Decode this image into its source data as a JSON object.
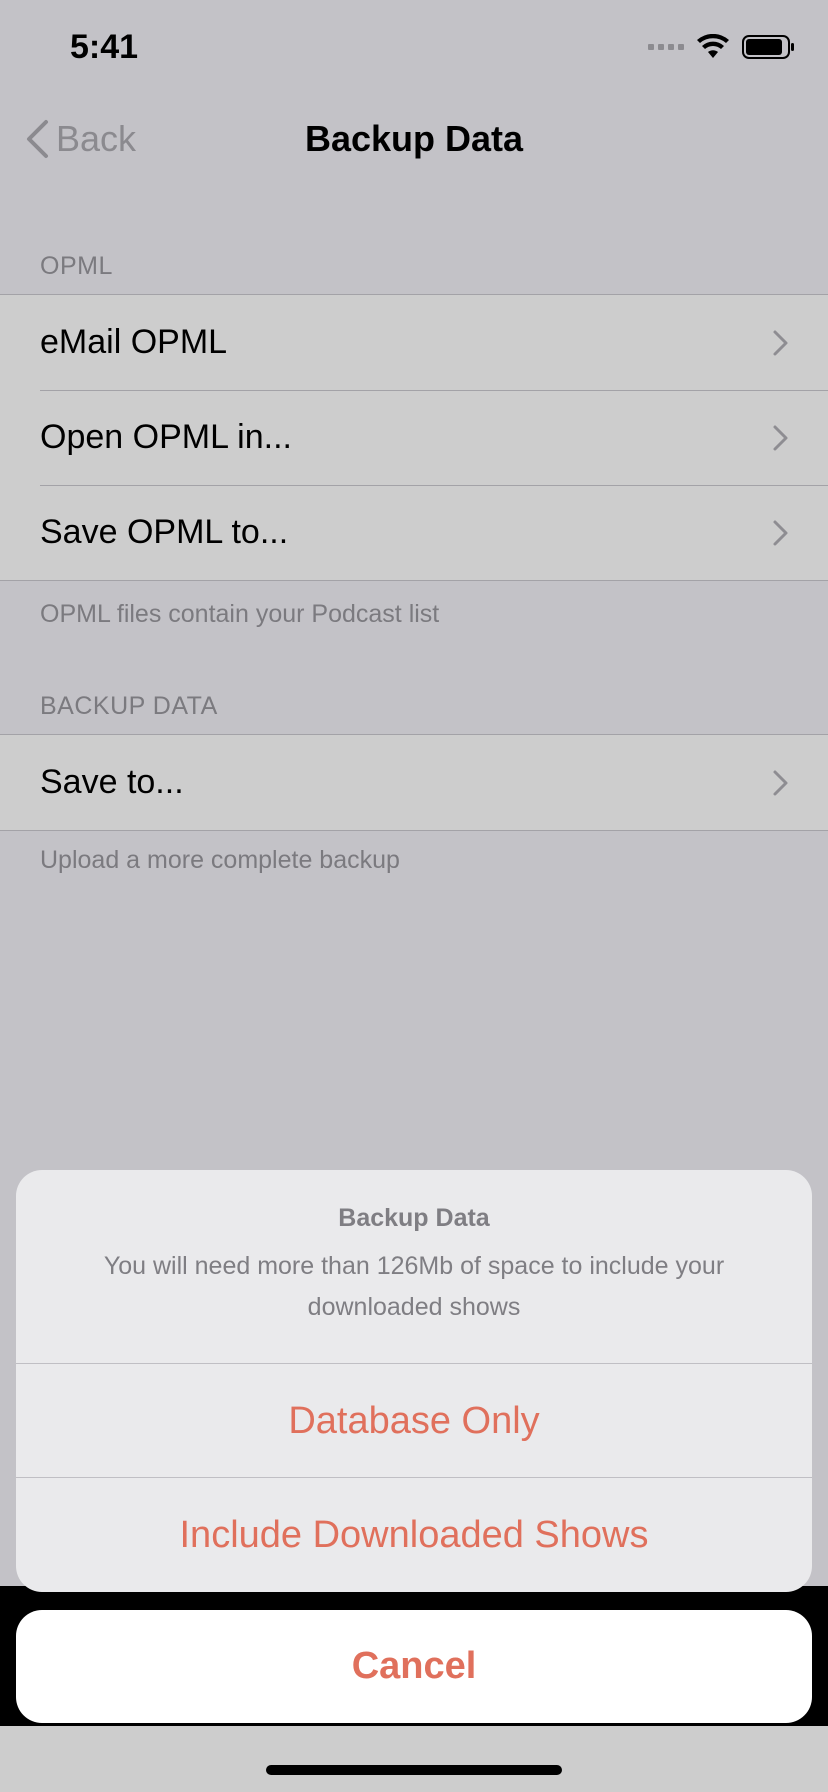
{
  "status_bar": {
    "time": "5:41",
    "icons": [
      "signal-icon",
      "wifi-icon",
      "battery-icon"
    ]
  },
  "nav": {
    "back_label": "Back",
    "title": "Backup Data"
  },
  "opml_section": {
    "header": "OPML",
    "items": [
      {
        "label": "eMail OPML"
      },
      {
        "label": "Open OPML in..."
      },
      {
        "label": "Save OPML to..."
      }
    ],
    "footer": "OPML files contain your Podcast list"
  },
  "backup_section": {
    "header": "BACKUP DATA",
    "items": [
      {
        "label": "Save to..."
      }
    ],
    "footer": "Upload a more complete backup"
  },
  "action_sheet": {
    "title": "Backup Data",
    "message": "You will need more than 126Mb of space to include your downloaded shows",
    "options": [
      {
        "label": "Database Only"
      },
      {
        "label": "Include Downloaded Shows"
      }
    ],
    "cancel_label": "Cancel"
  },
  "colors": {
    "accent": "#e0705c",
    "dimmed_background": "#c3c2c7"
  }
}
